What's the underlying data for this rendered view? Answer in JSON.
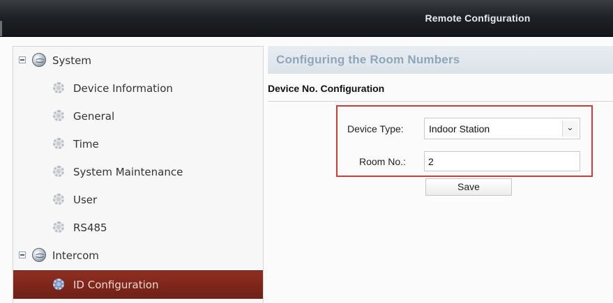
{
  "window": {
    "title": "Remote Configuration"
  },
  "sidebar": {
    "groups": [
      {
        "label": "System",
        "items": [
          {
            "label": "Device Information"
          },
          {
            "label": "General"
          },
          {
            "label": "Time"
          },
          {
            "label": "System Maintenance"
          },
          {
            "label": "User"
          },
          {
            "label": "RS485"
          }
        ]
      },
      {
        "label": "Intercom",
        "items": [
          {
            "label": "ID Configuration",
            "selected": true
          }
        ]
      }
    ]
  },
  "main": {
    "section_title": "Configuring the Room Numbers",
    "subsection_title": "Device No. Configuration",
    "form": {
      "device_type_label": "Device Type:",
      "device_type_value": "Indoor Station",
      "room_no_label": "Room No.:",
      "room_no_value": "2",
      "save_label": "Save"
    }
  },
  "colors": {
    "highlight_border": "#d23a3a",
    "selected_item": "#7b2519",
    "section_title": "#8fa5b8"
  }
}
